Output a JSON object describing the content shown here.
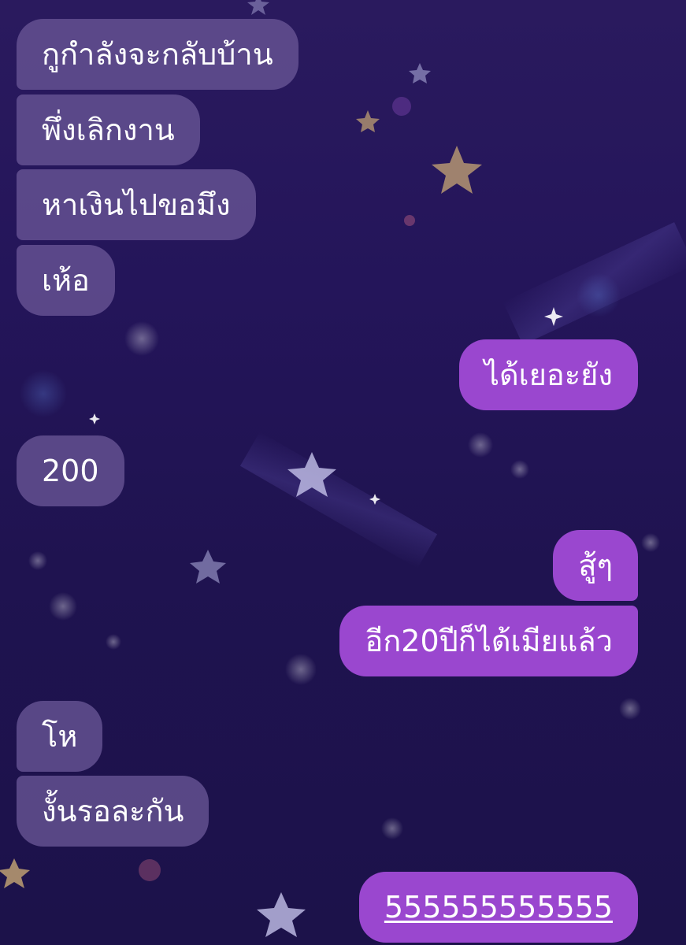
{
  "messages": [
    {
      "id": "m1",
      "side": "incoming",
      "text": "กูกำลังจะกลับบ้าน"
    },
    {
      "id": "m2",
      "side": "incoming",
      "text": "พึ่งเลิกงาน"
    },
    {
      "id": "m3",
      "side": "incoming",
      "text": "หาเงินไปขอมึง"
    },
    {
      "id": "m4",
      "side": "incoming",
      "text": "เห้อ"
    },
    {
      "id": "m5",
      "side": "outgoing",
      "text": "ได้เยอะยัง"
    },
    {
      "id": "m6",
      "side": "incoming",
      "text": "200"
    },
    {
      "id": "m7",
      "side": "outgoing",
      "text": "สู้ๆ"
    },
    {
      "id": "m8",
      "side": "outgoing",
      "text": "อีก20ปีก็ได้เมียแล้ว"
    },
    {
      "id": "m9",
      "side": "incoming",
      "text": "โห"
    },
    {
      "id": "m10",
      "side": "incoming",
      "text": "งั้นรอละกัน"
    },
    {
      "id": "m11",
      "side": "outgoing",
      "text": "555555555555",
      "is_link": true
    }
  ],
  "colors": {
    "background": "#24155a",
    "incoming_bubble": "#6956a0",
    "outgoing_bubble": "#9a47cf",
    "text": "#ffffff"
  },
  "background_icons": [
    "star-icon",
    "sparkle-icon",
    "bokeh-light"
  ]
}
